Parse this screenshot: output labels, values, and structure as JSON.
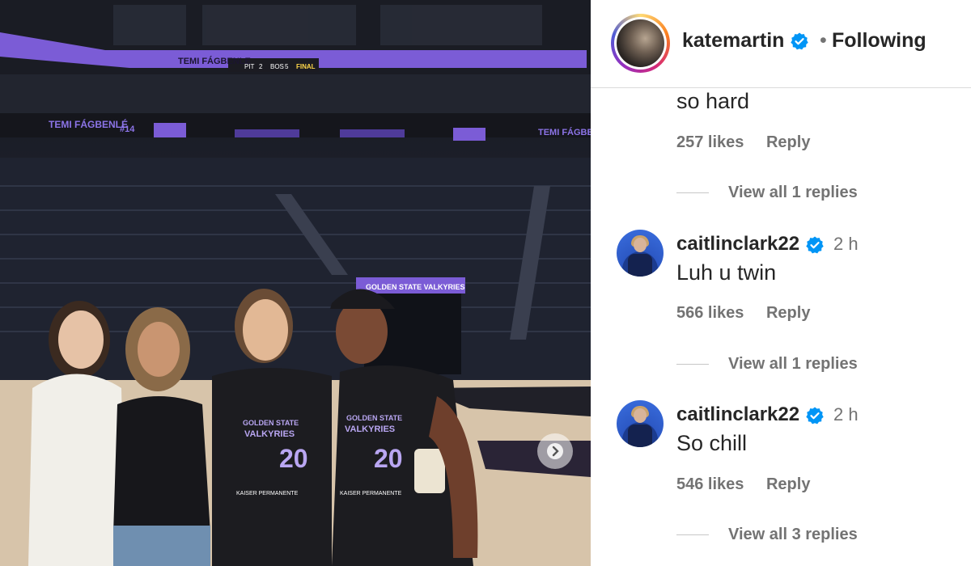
{
  "photo": {
    "scoreboard_name": "TEMI FÁGBENLE",
    "scoreboard_team1": "PIT",
    "scoreboard_score1": "2",
    "scoreboard_team2": "BOS",
    "scoreboard_score2": "5",
    "scoreboard_status": "FINAL",
    "ribbon_name_left": "TEMI FÁGBENLÉ",
    "ribbon_number": "#14",
    "ribbon_name_right": "TEMI FÁGBEN",
    "tunnel_sign": "GOLDEN STATE VALKYRIES",
    "jersey_team_line1": "GOLDEN STATE",
    "jersey_team_line2": "VALKYRIES",
    "jersey_number": "20",
    "jersey_sponsor": "KAISER PERMANENTE",
    "next_icon": "chevron-right-icon"
  },
  "header": {
    "username": "katemartin",
    "separator": "•",
    "follow_status": "Following"
  },
  "comments": [
    {
      "text": "so hard",
      "likes": "257 likes",
      "reply_label": "Reply",
      "view_replies": "View all 1 replies"
    },
    {
      "username": "caitlinclark22",
      "time": "2 h",
      "text": "Luh u twin",
      "likes": "566 likes",
      "reply_label": "Reply",
      "view_replies": "View all 1 replies"
    },
    {
      "username": "caitlinclark22",
      "time": "2 h",
      "text": "So chill",
      "likes": "546 likes",
      "reply_label": "Reply",
      "view_replies": "View all 3 replies"
    }
  ],
  "colors": {
    "verified": "#0095f6",
    "text_primary": "#262626",
    "text_secondary": "#737373",
    "arena_purple": "#7b5cd6"
  }
}
